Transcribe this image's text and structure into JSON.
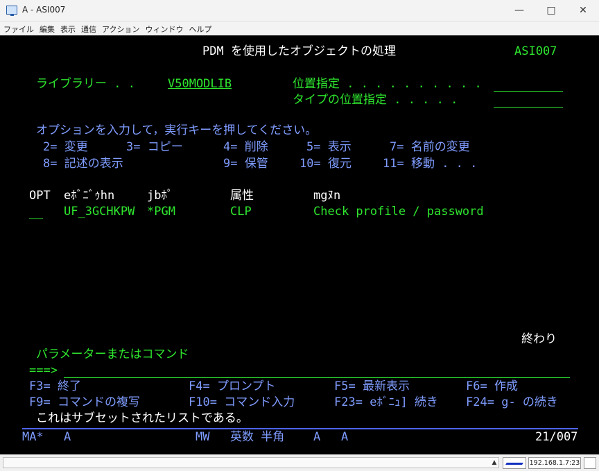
{
  "window": {
    "title": "A - ASI007",
    "minimize": "—",
    "maximize": "□",
    "close": "✕",
    "icon": "monitor-icon"
  },
  "menu": [
    "ファイル",
    "編集",
    "表示",
    "通信",
    "アクション",
    "ウィンドウ",
    "ヘルプ"
  ],
  "screen": {
    "title": "PDM を使用したオブジェクトの処理",
    "system": "ASI007",
    "library_label": "ライブラリー . .",
    "library_value": "V50MODLIB",
    "position_label": "位置指定 . . . . . . . . . .",
    "type_position_label": "タイプの位置指定 . . . . .",
    "instruction": "オプションを入力して，実行キーを押してください。",
    "options_row1": [
      {
        "key": "2=",
        "label": "変更"
      },
      {
        "key": "3=",
        "label": "コピー"
      },
      {
        "key": "4=",
        "label": "削除"
      },
      {
        "key": "5=",
        "label": "表示"
      },
      {
        "key": "7=",
        "label": "名前の変更"
      }
    ],
    "options_row2": [
      {
        "key": "8=",
        "label": "記述の表示"
      },
      {
        "key": "9=",
        "label": "保管"
      },
      {
        "key": "10=",
        "label": "復元"
      },
      {
        "key": "11=",
        "label": "移動 . . ."
      }
    ],
    "columns": [
      "OPT",
      "eﾎﾞﾆﾞｩhn",
      "jbﾎﾟ",
      "属性",
      "mgﾇn"
    ],
    "rows": [
      {
        "opt": "",
        "object": "UF_3GCHKPW",
        "type": "*PGM",
        "attribute": "CLP",
        "text": "Check profile / password"
      }
    ],
    "end_label": "終わり",
    "param_label": "パラメーターまたはコマンド",
    "prompt": "===>",
    "fkeys_row1": [
      {
        "key": "F3=",
        "label": "終了"
      },
      {
        "key": "F4=",
        "label": "プロンプト"
      },
      {
        "key": "F5=",
        "label": "最新表示"
      },
      {
        "key": "F6=",
        "label": "作成"
      }
    ],
    "fkeys_row2": [
      {
        "key": "F9=",
        "label": "コマンドの複写"
      },
      {
        "key": "F10=",
        "label": "コマンド入力"
      },
      {
        "key": "F23=",
        "label": "eﾎﾞﾆｭ] 続き"
      },
      {
        "key": "F24=",
        "label": "g- の続き"
      }
    ],
    "message": "これはサブセットされたリストである。"
  },
  "oia": {
    "ma": "MA*",
    "a": "A",
    "mw": "MW",
    "mode": "英数 半角",
    "a2": "A",
    "a3": "A",
    "cursor": "21/007"
  },
  "status": {
    "ip": "192.168.1.7:23"
  }
}
